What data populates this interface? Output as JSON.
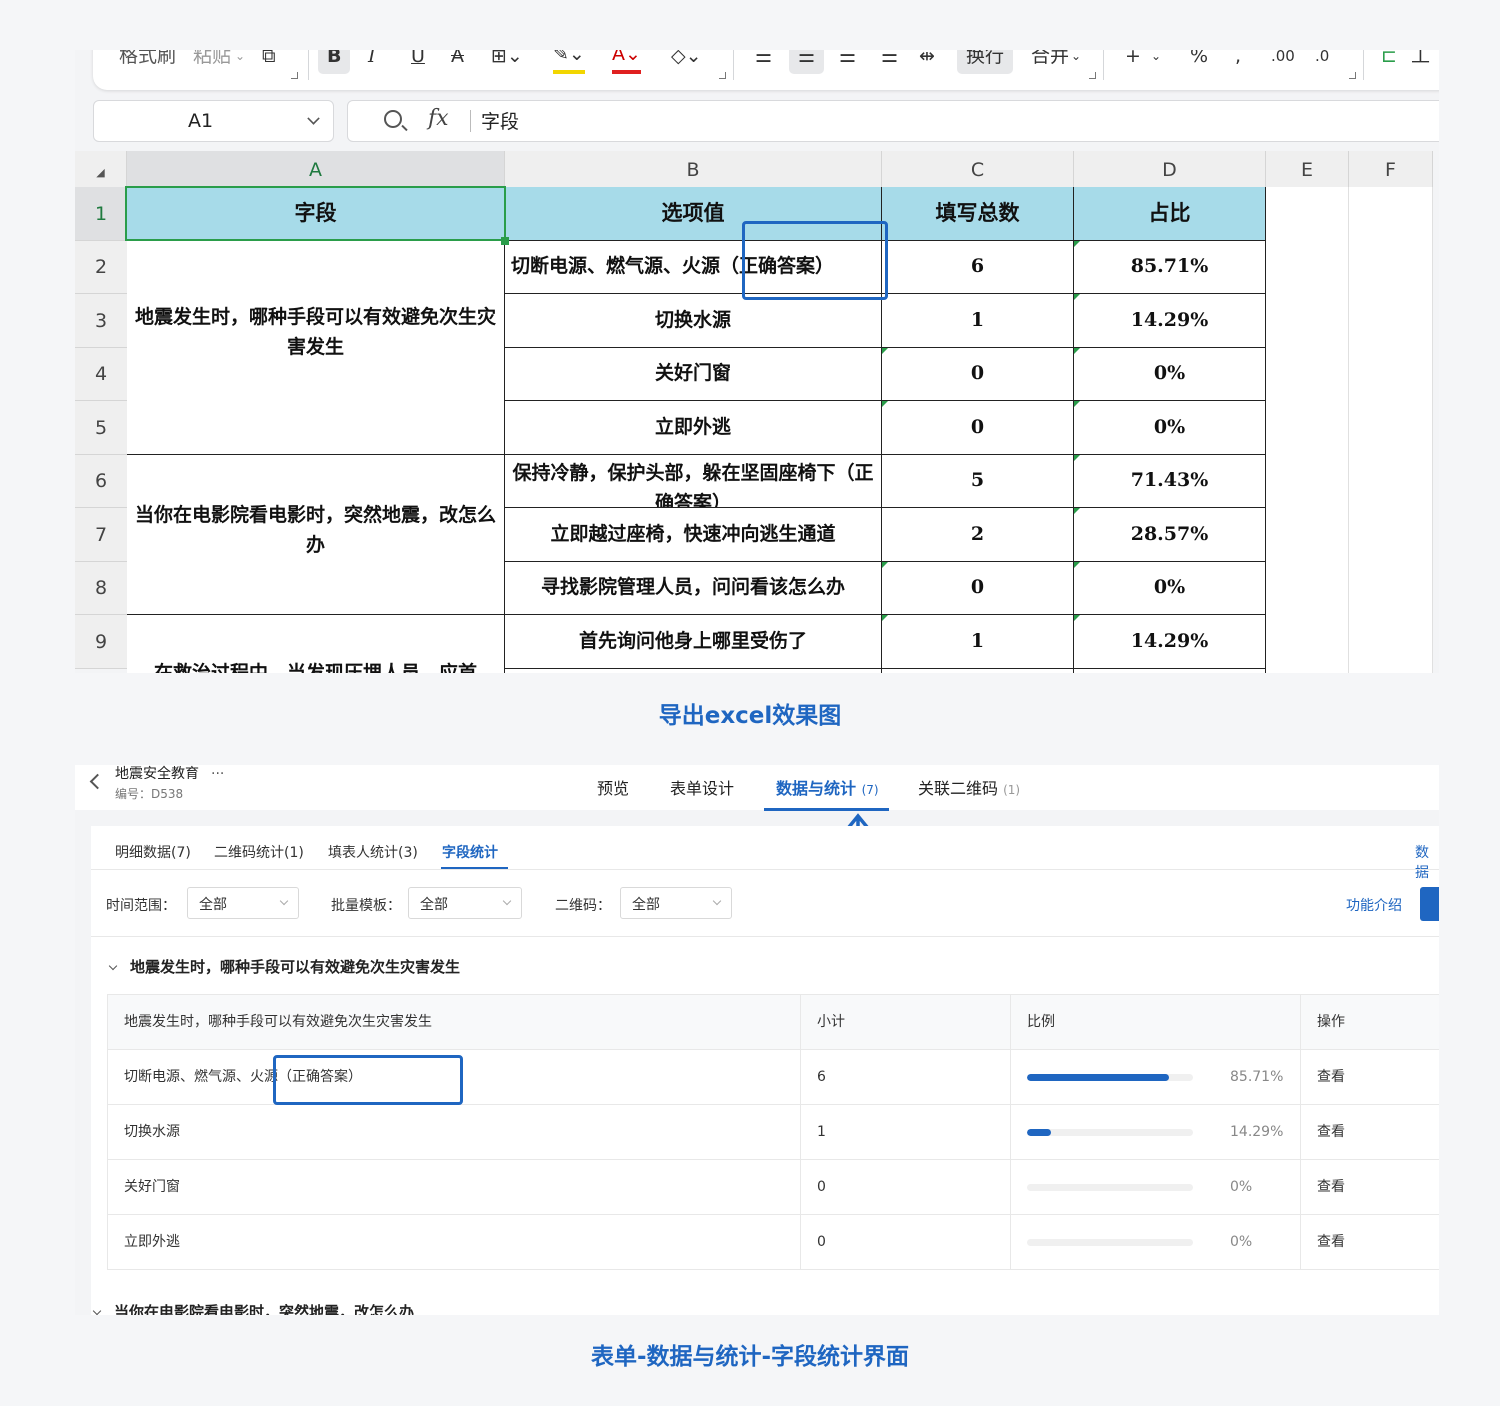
{
  "excel": {
    "ribbon": {
      "format_painter": "格式刷",
      "paste": "粘贴",
      "bold": "B",
      "italic": "I",
      "underline": "U",
      "strike": "A",
      "wrap": "换行",
      "merge": "合并",
      "sum": "+",
      "percent": "%",
      "comma": ",",
      "inc_decimal": ".00",
      "dec_decimal": ".0",
      "right_tool": "工"
    },
    "namebox": "A1",
    "fx": "fx",
    "formula_value": "字段",
    "columns": [
      "A",
      "B",
      "C",
      "D",
      "E",
      "F"
    ],
    "rows": [
      "1",
      "2",
      "3",
      "4",
      "5",
      "6",
      "7",
      "8",
      "9"
    ],
    "header": {
      "field": "字段",
      "option": "选项值",
      "total": "填写总数",
      "ratio": "占比"
    },
    "groups": [
      {
        "question": "地震发生时，哪种手段可以有效避免次生灾害发生"
      },
      {
        "question": "当你在电影院看电影时，突然地震，改怎么办"
      },
      {
        "question": "在救治过程中，当发现压埋人员，应首"
      }
    ],
    "data_rows": [
      {
        "option": "切断电源、燃气源、火源（正确答案）",
        "total": "6",
        "ratio": "85.71%"
      },
      {
        "option": "切换水源",
        "total": "1",
        "ratio": "14.29%"
      },
      {
        "option": "关好门窗",
        "total": "0",
        "ratio": "0%"
      },
      {
        "option": "立即外逃",
        "total": "0",
        "ratio": "0%"
      },
      {
        "option": "保持冷静，保护头部，躲在坚固座椅下（正确答案）",
        "total": "5",
        "ratio": "71.43%"
      },
      {
        "option": "立即越过座椅，快速冲向逃生通道",
        "total": "2",
        "ratio": "28.57%"
      },
      {
        "option": "寻找影院管理人员，问问看该怎么办",
        "total": "0",
        "ratio": "0%"
      },
      {
        "option": "首先询问他身上哪里受伤了",
        "total": "1",
        "ratio": "14.29%"
      }
    ]
  },
  "caption1": "导出excel效果图",
  "app": {
    "page_title": "地震安全教育",
    "more": "···",
    "code": "编号：D538",
    "tabs": [
      {
        "label": "预览",
        "count": ""
      },
      {
        "label": "表单设计",
        "count": ""
      },
      {
        "label": "数据与统计",
        "count": "(7)"
      },
      {
        "label": "关联二维码",
        "count": "(1)"
      }
    ],
    "subtabs": [
      "明细数据(7)",
      "二维码统计(1)",
      "填表人统计(3)",
      "字段统计"
    ],
    "right_link": "数据",
    "filters": [
      {
        "label": "时间范围：",
        "value": "全部"
      },
      {
        "label": "批量模板：",
        "value": "全部"
      },
      {
        "label": "二维码：",
        "value": "全部"
      }
    ],
    "feature_intro": "功能介绍",
    "section_title": "地震发生时，哪种手段可以有效避免次生灾害发生",
    "table_header": {
      "question": "地震发生时，哪种手段可以有效避免次生灾害发生",
      "subtotal": "小计",
      "ratio": "比例",
      "action": "操作"
    },
    "table_rows": [
      {
        "option": "切断电源、燃气源、火源（正确答案）",
        "subtotal": "6",
        "ratio_text": "85.71%",
        "ratio": 0.8571,
        "action": "查看"
      },
      {
        "option": "切换水源",
        "subtotal": "1",
        "ratio_text": "14.29%",
        "ratio": 0.1429,
        "action": "查看"
      },
      {
        "option": "关好门窗",
        "subtotal": "0",
        "ratio_text": "0%",
        "ratio": 0,
        "action": "查看"
      },
      {
        "option": "立即外逃",
        "subtotal": "0",
        "ratio_text": "0%",
        "ratio": 0,
        "action": "查看"
      }
    ],
    "next_section_title": "当你在电影院看电影时，突然地震，改怎么办"
  },
  "caption2": "表单-数据与统计-字段统计界面",
  "colors": {
    "accent": "#1f66c1",
    "header_fill": "#a7dbe9",
    "selection": "#2a9d4a"
  }
}
